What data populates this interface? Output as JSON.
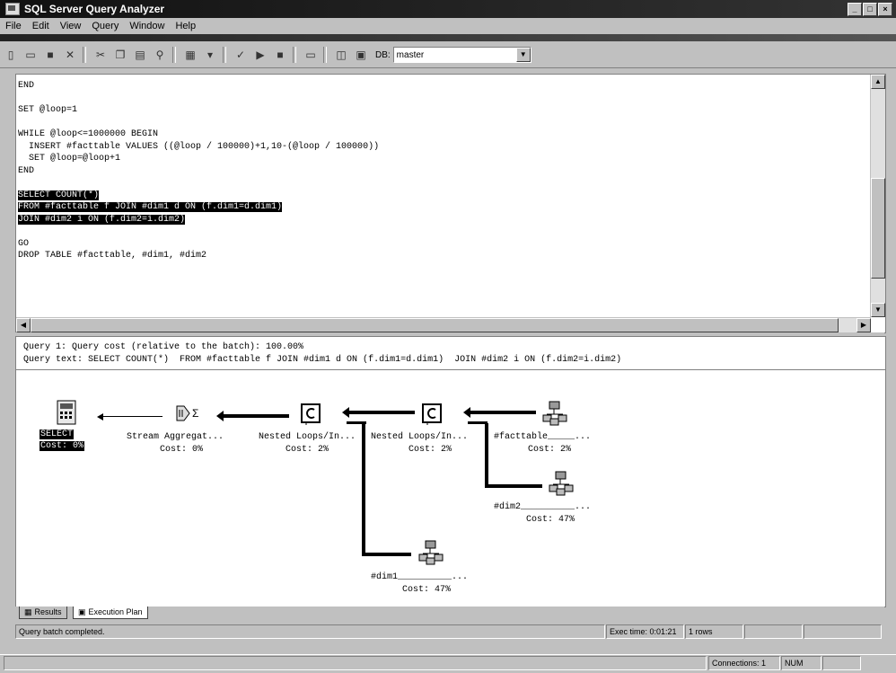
{
  "window": {
    "title": "SQL Server Query Analyzer",
    "buttons": [
      "_",
      "□",
      "×"
    ]
  },
  "menu": [
    "File",
    "Edit",
    "View",
    "Query",
    "Window",
    "Help"
  ],
  "toolbar": {
    "db_label": "DB:",
    "db_value": "master"
  },
  "editor": {
    "lines_before": [
      "END",
      "",
      "SET @loop=1",
      "",
      "WHILE @loop<=1000000 BEGIN",
      "  INSERT #facttable VALUES ((@loop / 100000)+1,10-(@loop / 100000))",
      "  SET @loop=@loop+1",
      "END",
      ""
    ],
    "highlighted": [
      "SELECT COUNT(*)",
      "FROM #facttable f JOIN #dim1 d ON (f.dim1=d.dim1)",
      "JOIN #dim2 i ON (f.dim2=i.dim2)"
    ],
    "lines_after": [
      "",
      "GO",
      "DROP TABLE #facttable, #dim1, #dim2"
    ]
  },
  "plan": {
    "query_header": "Query 1: Query cost (relative to the batch): 100.00%",
    "query_text": "Query text: SELECT COUNT(*)  FROM #facttable f JOIN #dim1 d ON (f.dim1=d.dim1)  JOIN #dim2 i ON (f.dim2=i.dim2)",
    "nodes": {
      "select": {
        "label": "SELECT",
        "cost": "Cost: 0%"
      },
      "stream": {
        "label": "Stream Aggregat...",
        "cost": "Cost: 0%"
      },
      "nested1": {
        "label": "Nested Loops/In...",
        "cost": "Cost: 2%"
      },
      "nested2": {
        "label": "Nested Loops/In...",
        "cost": "Cost: 2%"
      },
      "facttable": {
        "label": "#facttable_____...",
        "cost": "Cost: 2%"
      },
      "dim2": {
        "label": "#dim2__________...",
        "cost": "Cost: 47%"
      },
      "dim1": {
        "label": "#dim1__________...",
        "cost": "Cost: 47%"
      }
    }
  },
  "tabs": [
    {
      "label": "Results"
    },
    {
      "label": "Execution Plan"
    }
  ],
  "status": {
    "message": "Query batch completed.",
    "exec_time": "Exec time: 0:01:21",
    "rows": "1 rows"
  },
  "bottom": {
    "connections": "Connections: 1",
    "num": "NUM"
  }
}
